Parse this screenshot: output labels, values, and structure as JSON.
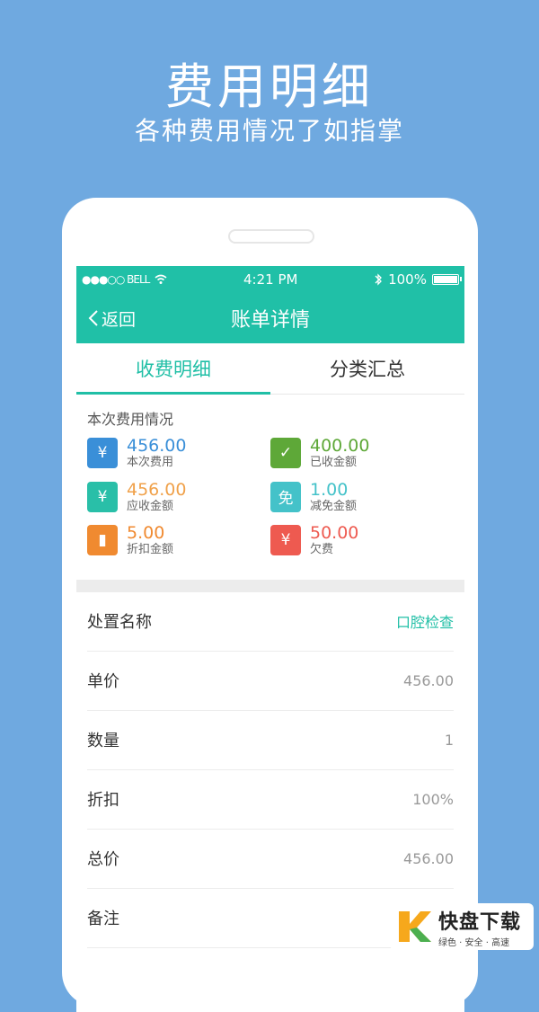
{
  "headline": "费用明细",
  "subline": "各种费用情况了如指掌",
  "status_bar": {
    "carrier": "●●●○○ BELL",
    "time": "4:21 PM",
    "battery": "100%"
  },
  "nav": {
    "back_label": "返回",
    "title": "账单详情"
  },
  "tabs": [
    {
      "label": "收费明细",
      "active": true
    },
    {
      "label": "分类汇总",
      "active": false
    }
  ],
  "summary": {
    "title": "本次费用情况",
    "items": [
      {
        "value": "456.00",
        "label": "本次费用",
        "color": "#3a8fd8",
        "icon_color": "#3a8fd8",
        "icon": "money-bag-icon",
        "glyph": "¥"
      },
      {
        "value": "400.00",
        "label": "已收金额",
        "color": "#5ea838",
        "icon_color": "#5ea838",
        "icon": "check-money-icon",
        "glyph": "✓"
      },
      {
        "value": "456.00",
        "label": "应收金额",
        "color": "#f0a14a",
        "icon_color": "#29bfa8",
        "icon": "house-money-icon",
        "glyph": "¥"
      },
      {
        "value": "1.00",
        "label": "减免金额",
        "color": "#44c2c9",
        "icon_color": "#44c2c9",
        "icon": "exempt-icon",
        "glyph": "免"
      },
      {
        "value": "5.00",
        "label": "折扣金额",
        "color": "#f08a30",
        "icon_color": "#f08a30",
        "icon": "discount-card-icon",
        "glyph": "▮"
      },
      {
        "value": "50.00",
        "label": "欠费",
        "color": "#ee5a50",
        "icon_color": "#ee5a50",
        "icon": "arrears-icon",
        "glyph": "¥"
      }
    ]
  },
  "details": [
    {
      "label": "处置名称",
      "value": "口腔检查",
      "link": true
    },
    {
      "label": "单价",
      "value": "456.00"
    },
    {
      "label": "数量",
      "value": "1"
    },
    {
      "label": "折扣",
      "value": "100%"
    },
    {
      "label": "总价",
      "value": "456.00"
    },
    {
      "label": "备注",
      "value": ""
    }
  ],
  "watermark": {
    "brand": "快盘下载",
    "tagline": "绿色 · 安全 · 高速"
  }
}
